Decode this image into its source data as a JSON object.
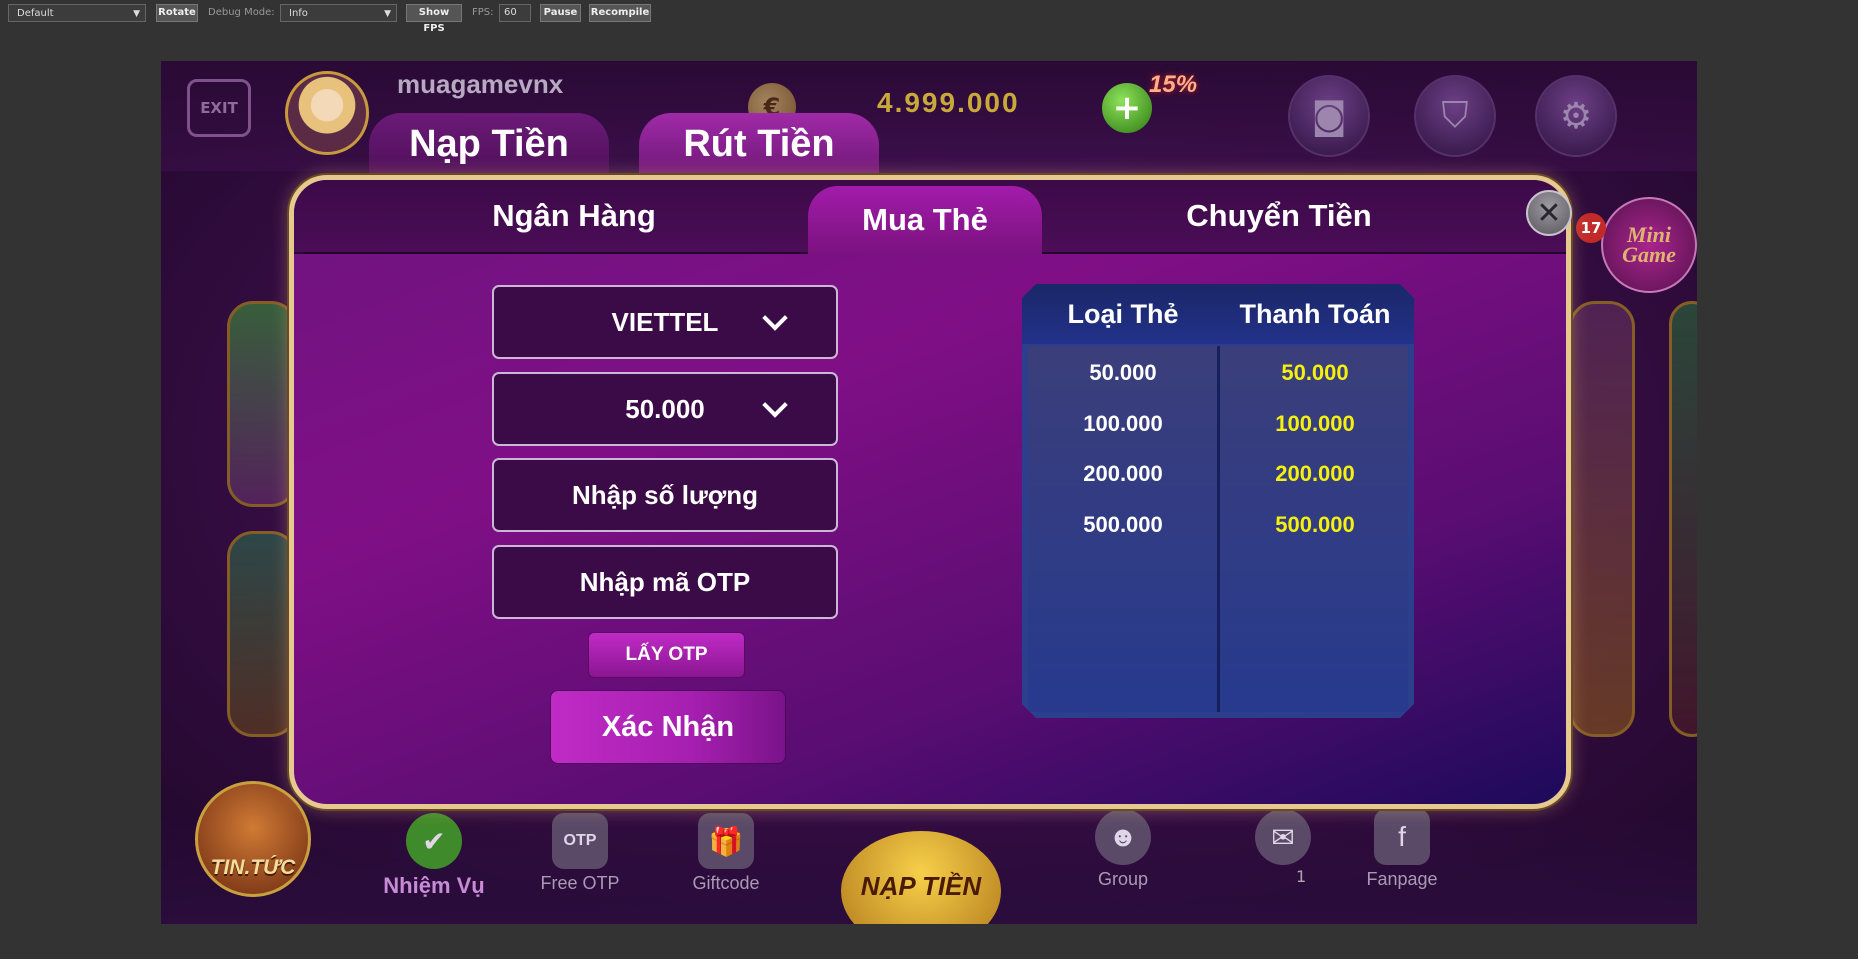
{
  "toolbar": {
    "preset_value": "Default",
    "rotate_label": "Rotate",
    "debug_mode_label": "Debug Mode:",
    "debug_mode_value": "Info",
    "show_fps_label": "Show FPS",
    "fps_label": "FPS:",
    "fps_value": "60",
    "pause_label": "Pause",
    "recompile_label": "Recompile"
  },
  "header": {
    "exit_label": "EXIT",
    "username": "muagamevnx",
    "balance": "4.999.000",
    "bonus_badge": "15%",
    "mini_game_count": "17",
    "mini_game_label_1": "Mini",
    "mini_game_label_2": "Game"
  },
  "dialog": {
    "tabs": [
      "Nạp Tiền",
      "Rút Tiền"
    ],
    "active_tab": "Rút Tiền",
    "subtabs": [
      "Ngân Hàng",
      "Mua Thẻ",
      "Chuyển Tiền"
    ],
    "active_subtab": "Mua Thẻ",
    "carrier_value": "VIETTEL",
    "amount_value": "50.000",
    "quantity_placeholder": "Nhập số lượng",
    "otp_placeholder": "Nhập mã OTP",
    "get_otp_label": "LẤY OTP",
    "confirm_label": "Xác Nhận",
    "table": {
      "headers": [
        "Loại Thẻ",
        "Thanh Toán"
      ],
      "rows": [
        [
          "50.000",
          "50.000"
        ],
        [
          "100.000",
          "100.000"
        ],
        [
          "200.000",
          "200.000"
        ],
        [
          "500.000",
          "500.000"
        ]
      ]
    }
  },
  "bottom": {
    "news_label": "TIN.TỨC",
    "mission_label": "Nhiệm Vụ",
    "free_otp_label": "Free OTP",
    "otp_icon_label": "OTP",
    "giftcode_label": "Giftcode",
    "center_label": "NẠP TIỀN",
    "group_label": "Group",
    "mail_count": "1",
    "fanpage_label": "Fanpage"
  },
  "colors": {
    "accent": "#a21caa",
    "panel_border": "#e5c98f",
    "payout_text": "#f5f10e",
    "table_bg": "#2c3f8c"
  }
}
